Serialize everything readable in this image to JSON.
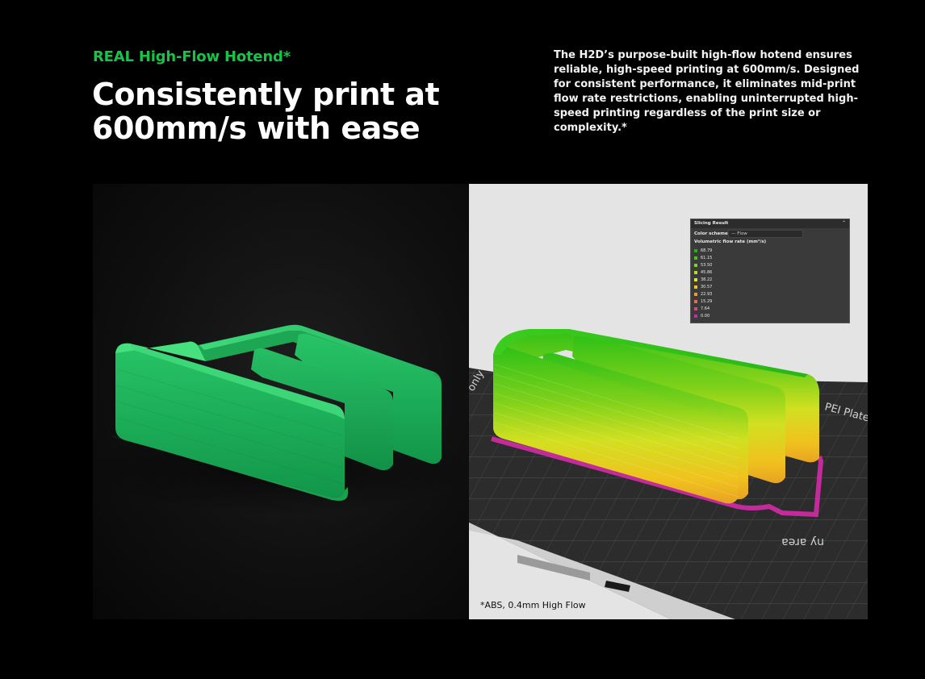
{
  "header": {
    "eyebrow": "REAL High-Flow Hotend*",
    "headline": "Consistently print at 600mm/s with ease",
    "description": "The H2D’s purpose-built high-flow hotend ensures reliable, high-speed printing at 600mm/s. Designed for consistent performance, it eliminates mid-print flow rate restrictions, enabling uninterrupted high-speed printing regardless of the print size or complexity.*"
  },
  "slicing_panel": {
    "title": "Slicing Result",
    "color_scheme_label": "Color scheme",
    "color_scheme_value": "Flow",
    "legend_title": "Volumetric flow rate (mm³/s)",
    "legend": [
      {
        "value": "68.79",
        "color": "#1bb70f"
      },
      {
        "value": "61.15",
        "color": "#4cc414"
      },
      {
        "value": "53.50",
        "color": "#7fd11a"
      },
      {
        "value": "45.86",
        "color": "#b3de1f"
      },
      {
        "value": "38.22",
        "color": "#e2e623"
      },
      {
        "value": "30.57",
        "color": "#f2c61f"
      },
      {
        "value": "22.93",
        "color": "#ef9a2b"
      },
      {
        "value": "15.29",
        "color": "#e66b4f"
      },
      {
        "value": "7.64",
        "color": "#d5477d"
      },
      {
        "value": "0.00",
        "color": "#c52bb0"
      }
    ]
  },
  "footnote": "*ABS, 0.4mm High Flow",
  "colors": {
    "accent": "#18c34a",
    "print_green": "#1fb35a",
    "background": "#000000"
  }
}
